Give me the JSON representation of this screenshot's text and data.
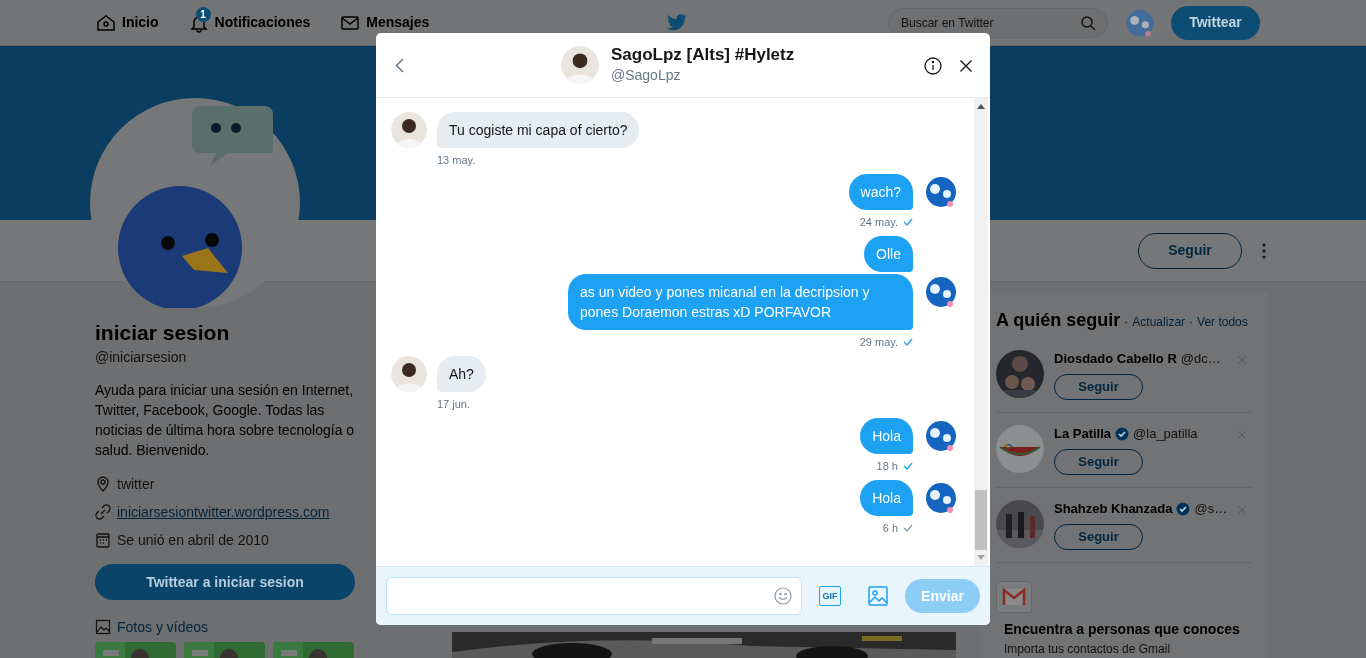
{
  "nav": {
    "items": [
      {
        "label": "Inicio"
      },
      {
        "label": "Notificaciones",
        "badge": "1"
      },
      {
        "label": "Mensajes"
      }
    ],
    "search": {
      "placeholder": "Buscar en Twitter"
    },
    "tweet_button": "Twittear"
  },
  "profile": {
    "name": "iniciar sesion",
    "handle": "@iniciarsesion",
    "bio": "Ayuda para iniciar una sesión en Internet, Twitter, Facebook, Google. Todas las noticias de última hora sobre tecnología o salud. Bienvenido.",
    "details": [
      {
        "text": "twitter",
        "link": false
      },
      {
        "text": "iniciarsesiontwitter.wordpress.com",
        "link": true
      },
      {
        "text": "Se unió en abril de 2010",
        "link": false
      }
    ],
    "tweet_button": "Twittear a iniciar sesion",
    "media_label": "Fotos y vídeos",
    "follow_button": "Seguir"
  },
  "who_to_follow": {
    "title": "A quién seguir",
    "separator": "·",
    "refresh": "Actualizar",
    "view_all": "Ver todos",
    "suggestions": [
      {
        "name": "Diosdado Cabello R",
        "verified": false,
        "handle": "@dc…",
        "button": "Seguir"
      },
      {
        "name": "La Patilla",
        "verified": true,
        "handle": "@la_patilla",
        "button": "Seguir"
      },
      {
        "name": "Shahzeb Khanzada",
        "verified": true,
        "handle": "@s…",
        "button": "Seguir"
      }
    ]
  },
  "find_people": {
    "title": "Encuentra a personas que conoces",
    "subtitle": "Importa tus contactos de Gmail"
  },
  "conversation": {
    "name": "SagoLpz [Alts] #Hyletz",
    "handle": "@SagoLpz",
    "messages": [
      {
        "kind": "received",
        "text": "Tu cogiste mi capa of cierto?",
        "time": "13 may.",
        "avatar": true
      },
      {
        "kind": "sent",
        "text": "wach?",
        "time": "24 may.",
        "seen": true,
        "avatar": true
      },
      {
        "kind": "sent",
        "text": "Olle",
        "avatar": false
      },
      {
        "kind": "sent",
        "text": "as un video y pones micanal en la decripsion y pones Doraemon estras xD PORFAVOR",
        "time": "29 may.",
        "seen": true,
        "avatar": true
      },
      {
        "kind": "received",
        "text": "Ah?",
        "time": "17 jun.",
        "avatar": true
      },
      {
        "kind": "sent",
        "text": "Hola",
        "time": "18 h",
        "seen": true,
        "avatar": true
      },
      {
        "kind": "sent",
        "text": "Hola",
        "time": "6 h",
        "seen": false,
        "avatar": true
      }
    ],
    "composer": {
      "gif_label": "GIF",
      "send": "Enviar",
      "send_disabled": true
    }
  }
}
